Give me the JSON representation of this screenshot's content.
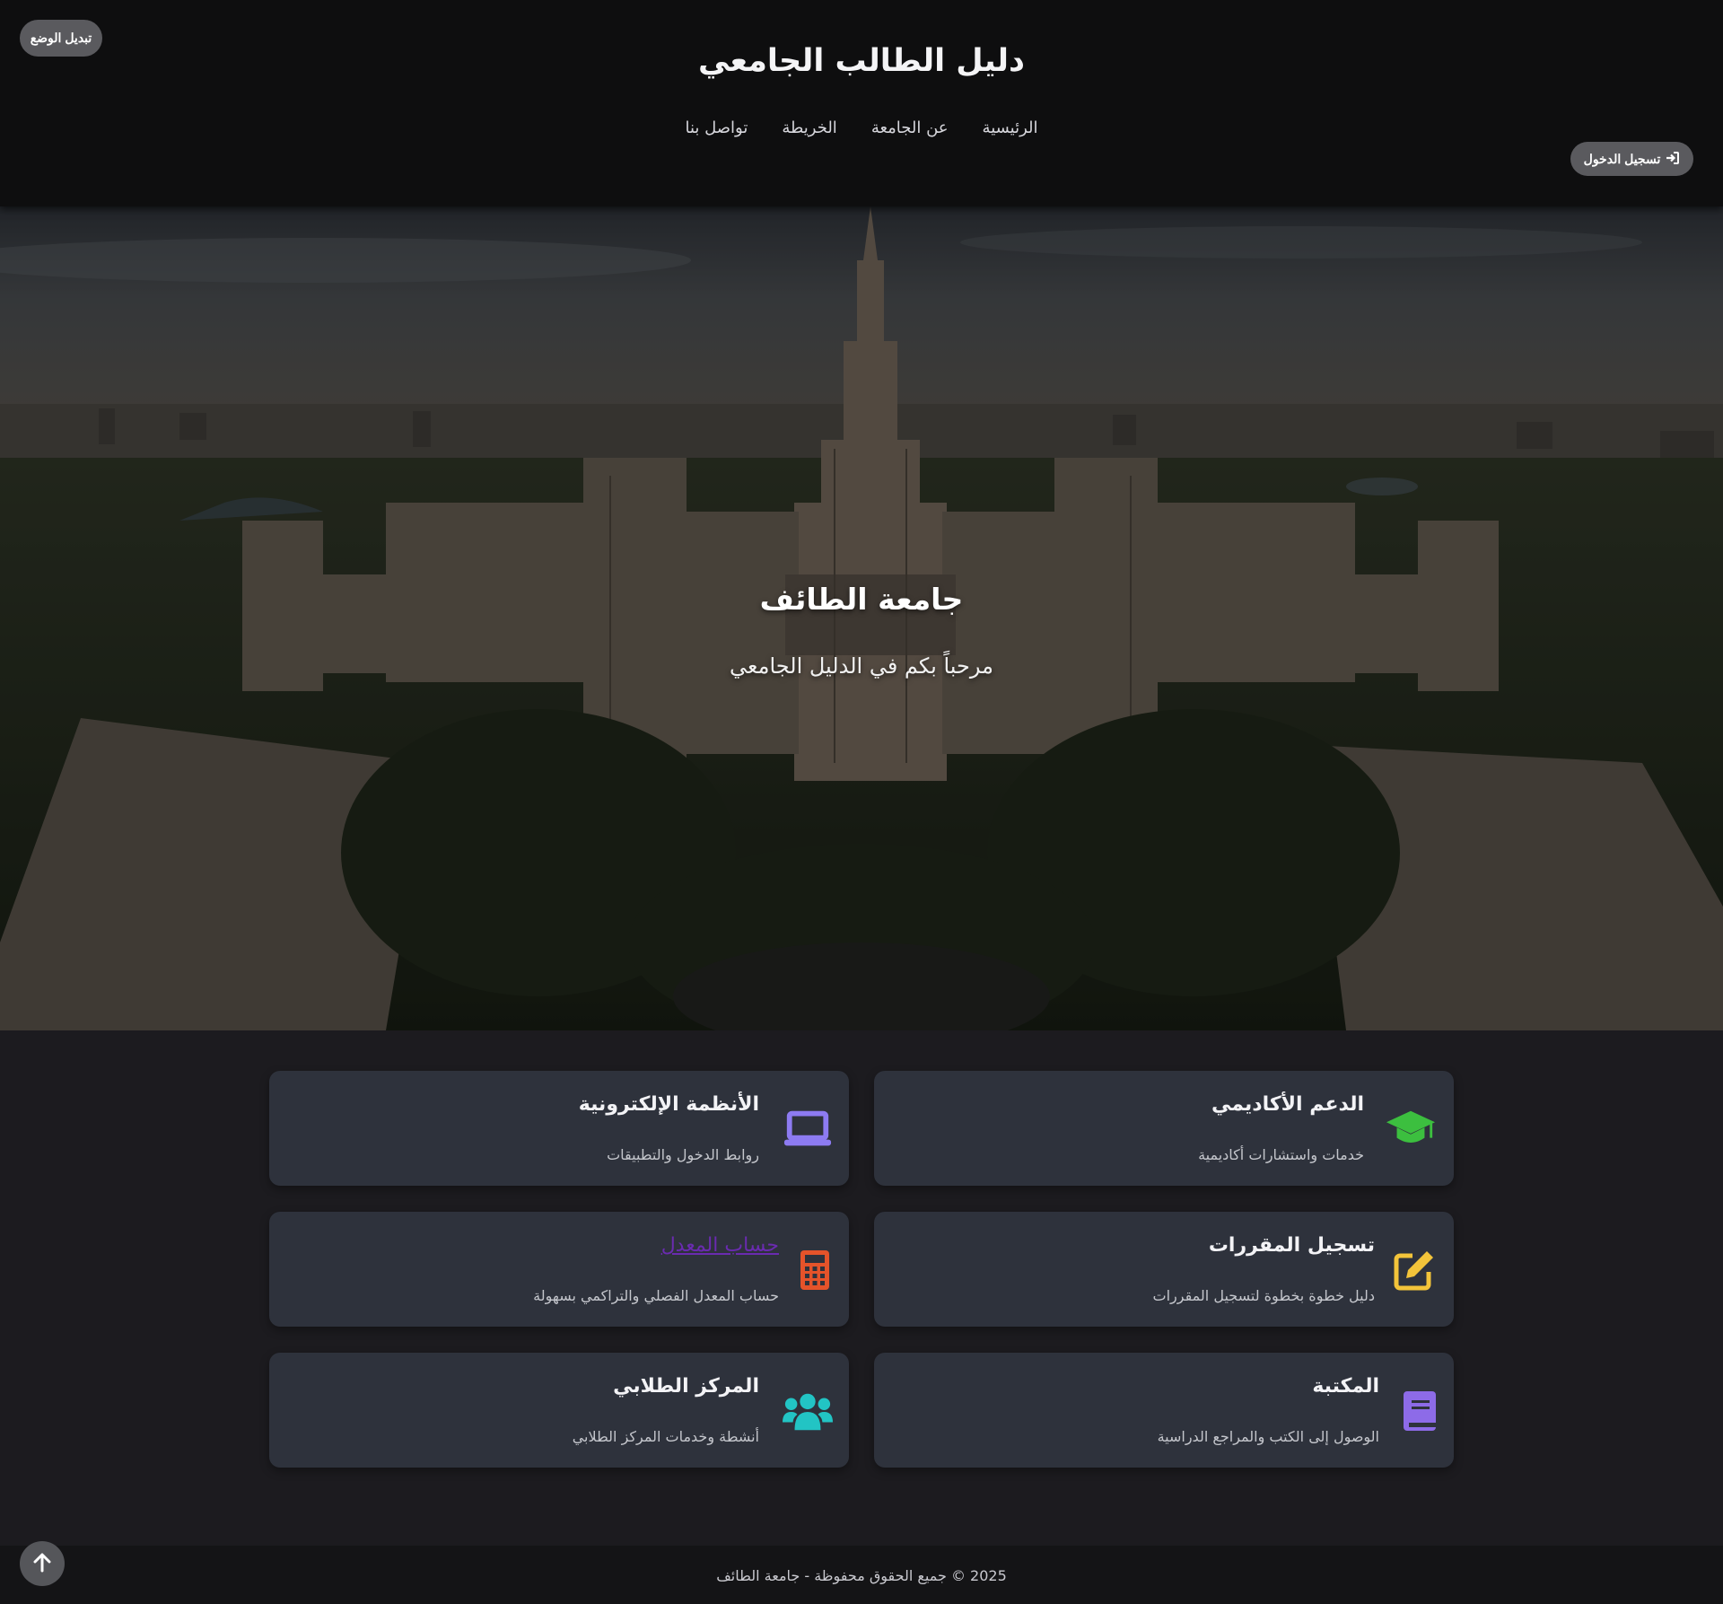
{
  "header": {
    "site_title": "دليل الطالب الجامعي",
    "nav": [
      "الرئيسية",
      "عن الجامعة",
      "الخريطة",
      "تواصل بنا"
    ],
    "mode_toggle_label": "تبديل الوضع",
    "login_label": "تسجيل الدخول"
  },
  "hero": {
    "title": "جامعة الطائف",
    "subtitle": "مرحباً بكم في الدليل الجامعي"
  },
  "cards": [
    {
      "title": "الدعم الأكاديمي",
      "desc": "خدمات واستشارات أكاديمية",
      "icon": "graduation-cap-icon",
      "color": "#3cbf3f"
    },
    {
      "title": "الأنظمة الإلكترونية",
      "desc": "روابط الدخول والتطبيقات",
      "icon": "laptop-icon",
      "color": "#8d7bf2"
    },
    {
      "title": "تسجيل المقررات",
      "desc": "دليل خطوة بخطوة لتسجيل المقررات",
      "icon": "edit-icon",
      "color": "#f3c43a"
    },
    {
      "title": "حساب المعدل",
      "desc": "حساب المعدل الفصلي والتراكمي بسهولة",
      "icon": "calculator-icon",
      "color": "#e5532a"
    },
    {
      "title": "المكتبة",
      "desc": "الوصول إلى الكتب والمراجع الدراسية",
      "icon": "book-icon",
      "color": "#8d6be8"
    },
    {
      "title": "المركز الطلابي",
      "desc": "أنشطة وخدمات المركز الطلابي",
      "icon": "users-icon",
      "color": "#22c4c4"
    }
  ],
  "footer": {
    "text": "2025 © جميع الحقوق محفوظة - جامعة الطائف"
  }
}
